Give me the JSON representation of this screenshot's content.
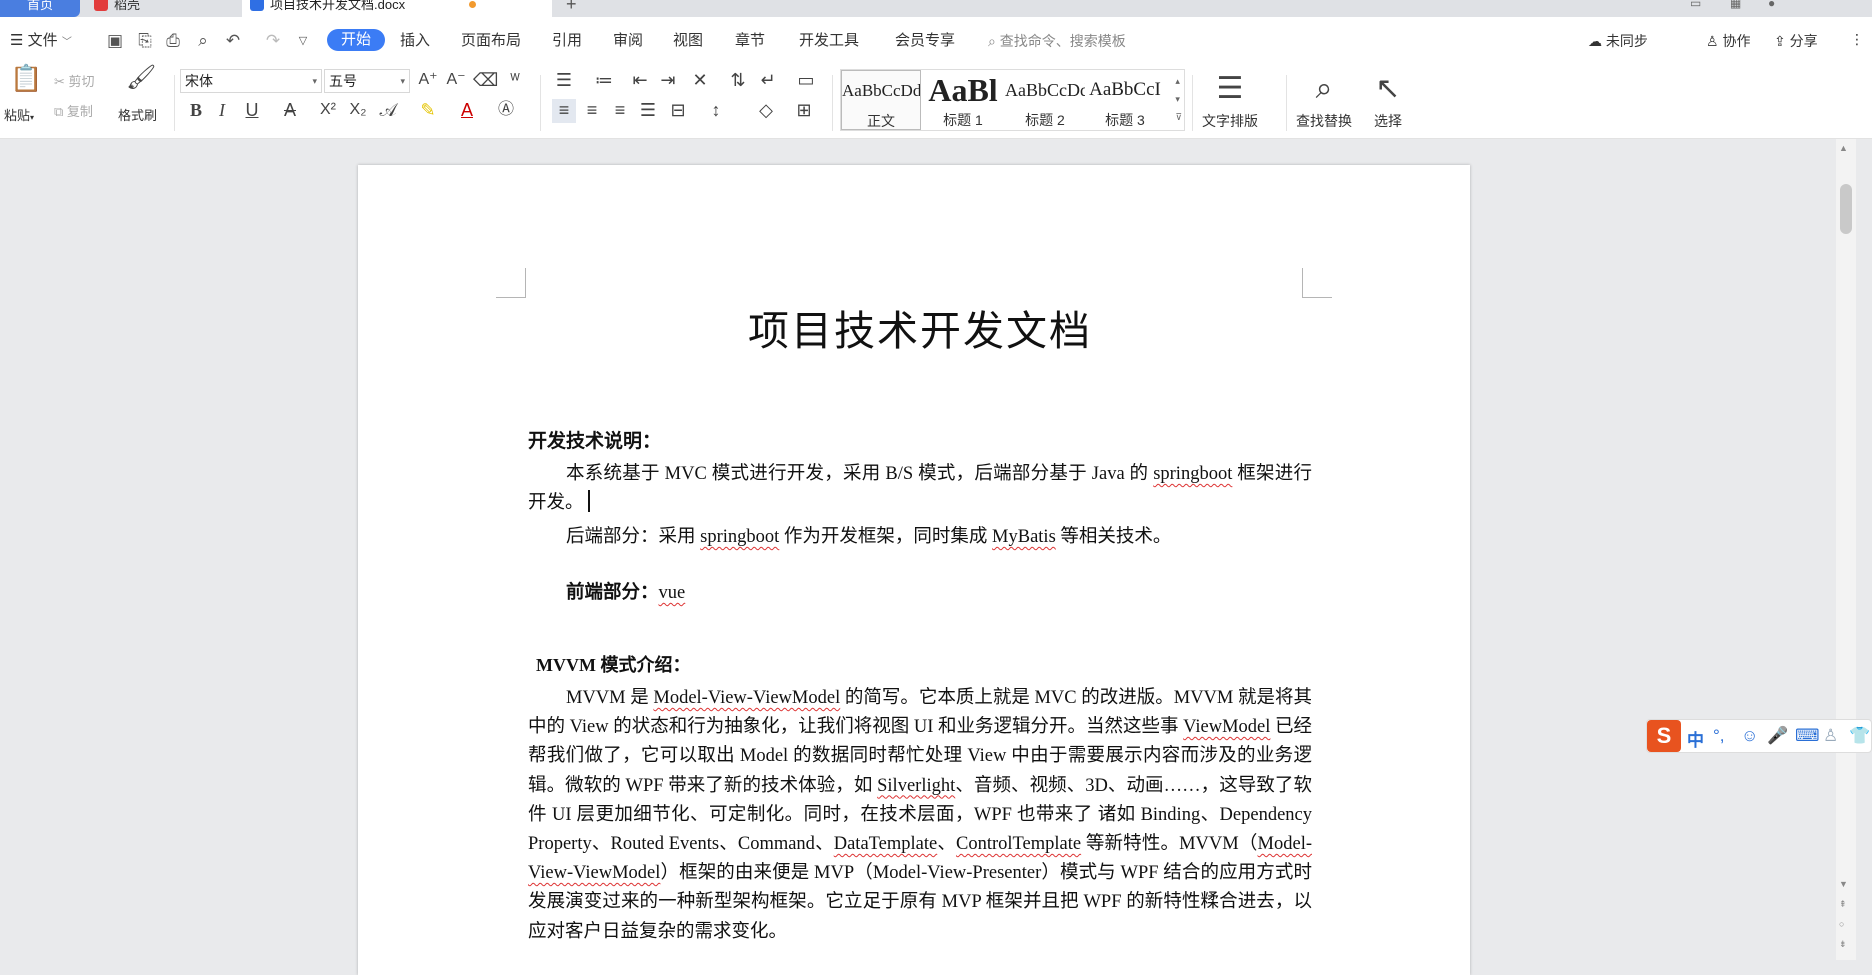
{
  "tabs": {
    "home": "首页",
    "inactive": "稻壳",
    "active": "项目技术开发文档.docx",
    "new_tab_icon": "plus-icon"
  },
  "menubar": {
    "file": "文件",
    "items": [
      "开始",
      "插入",
      "页面布局",
      "引用",
      "审阅",
      "视图",
      "章节",
      "开发工具",
      "会员专享"
    ],
    "search_placeholder": "查找命令、搜索模板",
    "sync": "未同步",
    "collab": "协作",
    "share": "分享"
  },
  "ribbon": {
    "paste": "粘贴",
    "cut": "剪切",
    "copy": "复制",
    "format_painter": "格式刷",
    "font_name": "宋体",
    "font_size": "五号",
    "styles": [
      {
        "preview": "AaBbCcDd",
        "name": "正文"
      },
      {
        "preview": "AaBl",
        "name": "标题 1"
      },
      {
        "preview": "AaBbCcDd",
        "name": "标题 2"
      },
      {
        "preview": "AaBbCcI",
        "name": "标题 3"
      }
    ],
    "text_layout": "文字排版",
    "find_replace": "查找替换",
    "select": "选择"
  },
  "document": {
    "title": "项目技术开发文档",
    "h1": "开发技术说明：",
    "p1_a": "本系统基于 MVC 模式进行开发，采用 B/S 模式，后端部分基于 Java 的 ",
    "p1_u": "springboot",
    "p1_b": " 框架进行开发。",
    "p2_a": "后端部分：采用 ",
    "p2_u1": "springboot",
    "p2_b": " 作为开发框架，同时集成 ",
    "p2_u2": "MyBatis",
    "p2_c": " 等相关技术。",
    "front_label": "前端部分：",
    "front_value": "vue",
    "h2": "MVVM 模式介绍：",
    "p3_a": "MVVM 是 ",
    "p3_u1": "Model-View-ViewModel",
    "p3_b": " 的简写。它本质上就是 MVC  的改进版。MVVM 就是将其中的 View  的状态和行为抽象化，让我们将视图 UI  和业务逻辑分开。当然这些事 ",
    "p3_u2": "ViewModel",
    "p3_c": " 已经帮我们做了，它可以取出 Model  的数据同时帮忙处理 View  中由于需要展示内容而涉及的业务逻辑。微软的 WPF 带来了新的技术体验，如 ",
    "p3_u3": "Silverlight",
    "p3_d": "、音频、视频、3D、动画……，这导致了软件 UI 层更加细节化、可定制化。同时，在技术层面，WPF 也带来了 诸如 Binding、Dependency Property、Routed Events、Command、",
    "p3_u4": "DataTemplate",
    "p3_e": "、",
    "p3_u5": "ControlTemplate",
    "p3_f": " 等新特性。MVVM（",
    "p3_u6": "Model-View-ViewModel",
    "p3_g": "）框架的由来便是 MVP（Model-View-Presenter）模式与 WPF 结合的应用方式时发展演变过来的一种新型架构框架。它立足于原有 MVP 框架并且把 WPF 的新特性糅合进去，以应对客户日益复杂的需求变化。"
  },
  "ime": {
    "lang": "中"
  }
}
